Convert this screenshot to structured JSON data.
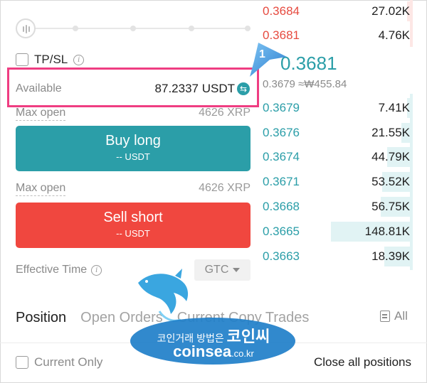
{
  "form": {
    "tpsl_label": "TP/SL",
    "available_label": "Available",
    "available_value": "87.2337 USDT",
    "max_open_label": "Max open",
    "max_open_long": "4626 XRP",
    "max_open_short": "4626 XRP",
    "buy_label": "Buy long",
    "buy_sub": "-- USDT",
    "sell_label": "Sell short",
    "sell_sub": "-- USDT",
    "effective_time_label": "Effective Time",
    "gtc_label": "GTC"
  },
  "orderbook": {
    "asks": [
      {
        "price": "0.3684",
        "qty": "27.02K",
        "depth": 0.05
      },
      {
        "price": "0.3681",
        "qty": "4.76K",
        "depth": 0.02
      }
    ],
    "last_price": "0.3681",
    "ref_price": "0.3679 ≈₩455.84",
    "bids": [
      {
        "price": "0.3679",
        "qty": "7.41K",
        "depth": 0.05
      },
      {
        "price": "0.3676",
        "qty": "21.55K",
        "depth": 0.12
      },
      {
        "price": "0.3674",
        "qty": "44.79K",
        "depth": 0.3
      },
      {
        "price": "0.3671",
        "qty": "53.52K",
        "depth": 0.36
      },
      {
        "price": "0.3668",
        "qty": "56.75K",
        "depth": 0.38
      },
      {
        "price": "0.3665",
        "qty": "148.81K",
        "depth": 1.0
      },
      {
        "price": "0.3663",
        "qty": "18.39K",
        "depth": 0.34
      }
    ]
  },
  "callout_number": "1",
  "tabs": [
    {
      "label": "Position",
      "active": true
    },
    {
      "label": "Open Orders",
      "active": false
    },
    {
      "label": "Current Copy Trades",
      "active": false
    }
  ],
  "all_label": "All",
  "current_only_label": "Current Only",
  "close_all_label": "Close all positions",
  "watermark": {
    "line1_small": "코인거래 방법은",
    "line1_big": "코인씨",
    "line2_main": "coinsea",
    "line2_suffix": ".co.kr"
  },
  "colors": {
    "accent": "#2b9ea8",
    "sell": "#f0473f",
    "ask_text": "#e64a3f",
    "highlight_box": "#ef3d82"
  }
}
